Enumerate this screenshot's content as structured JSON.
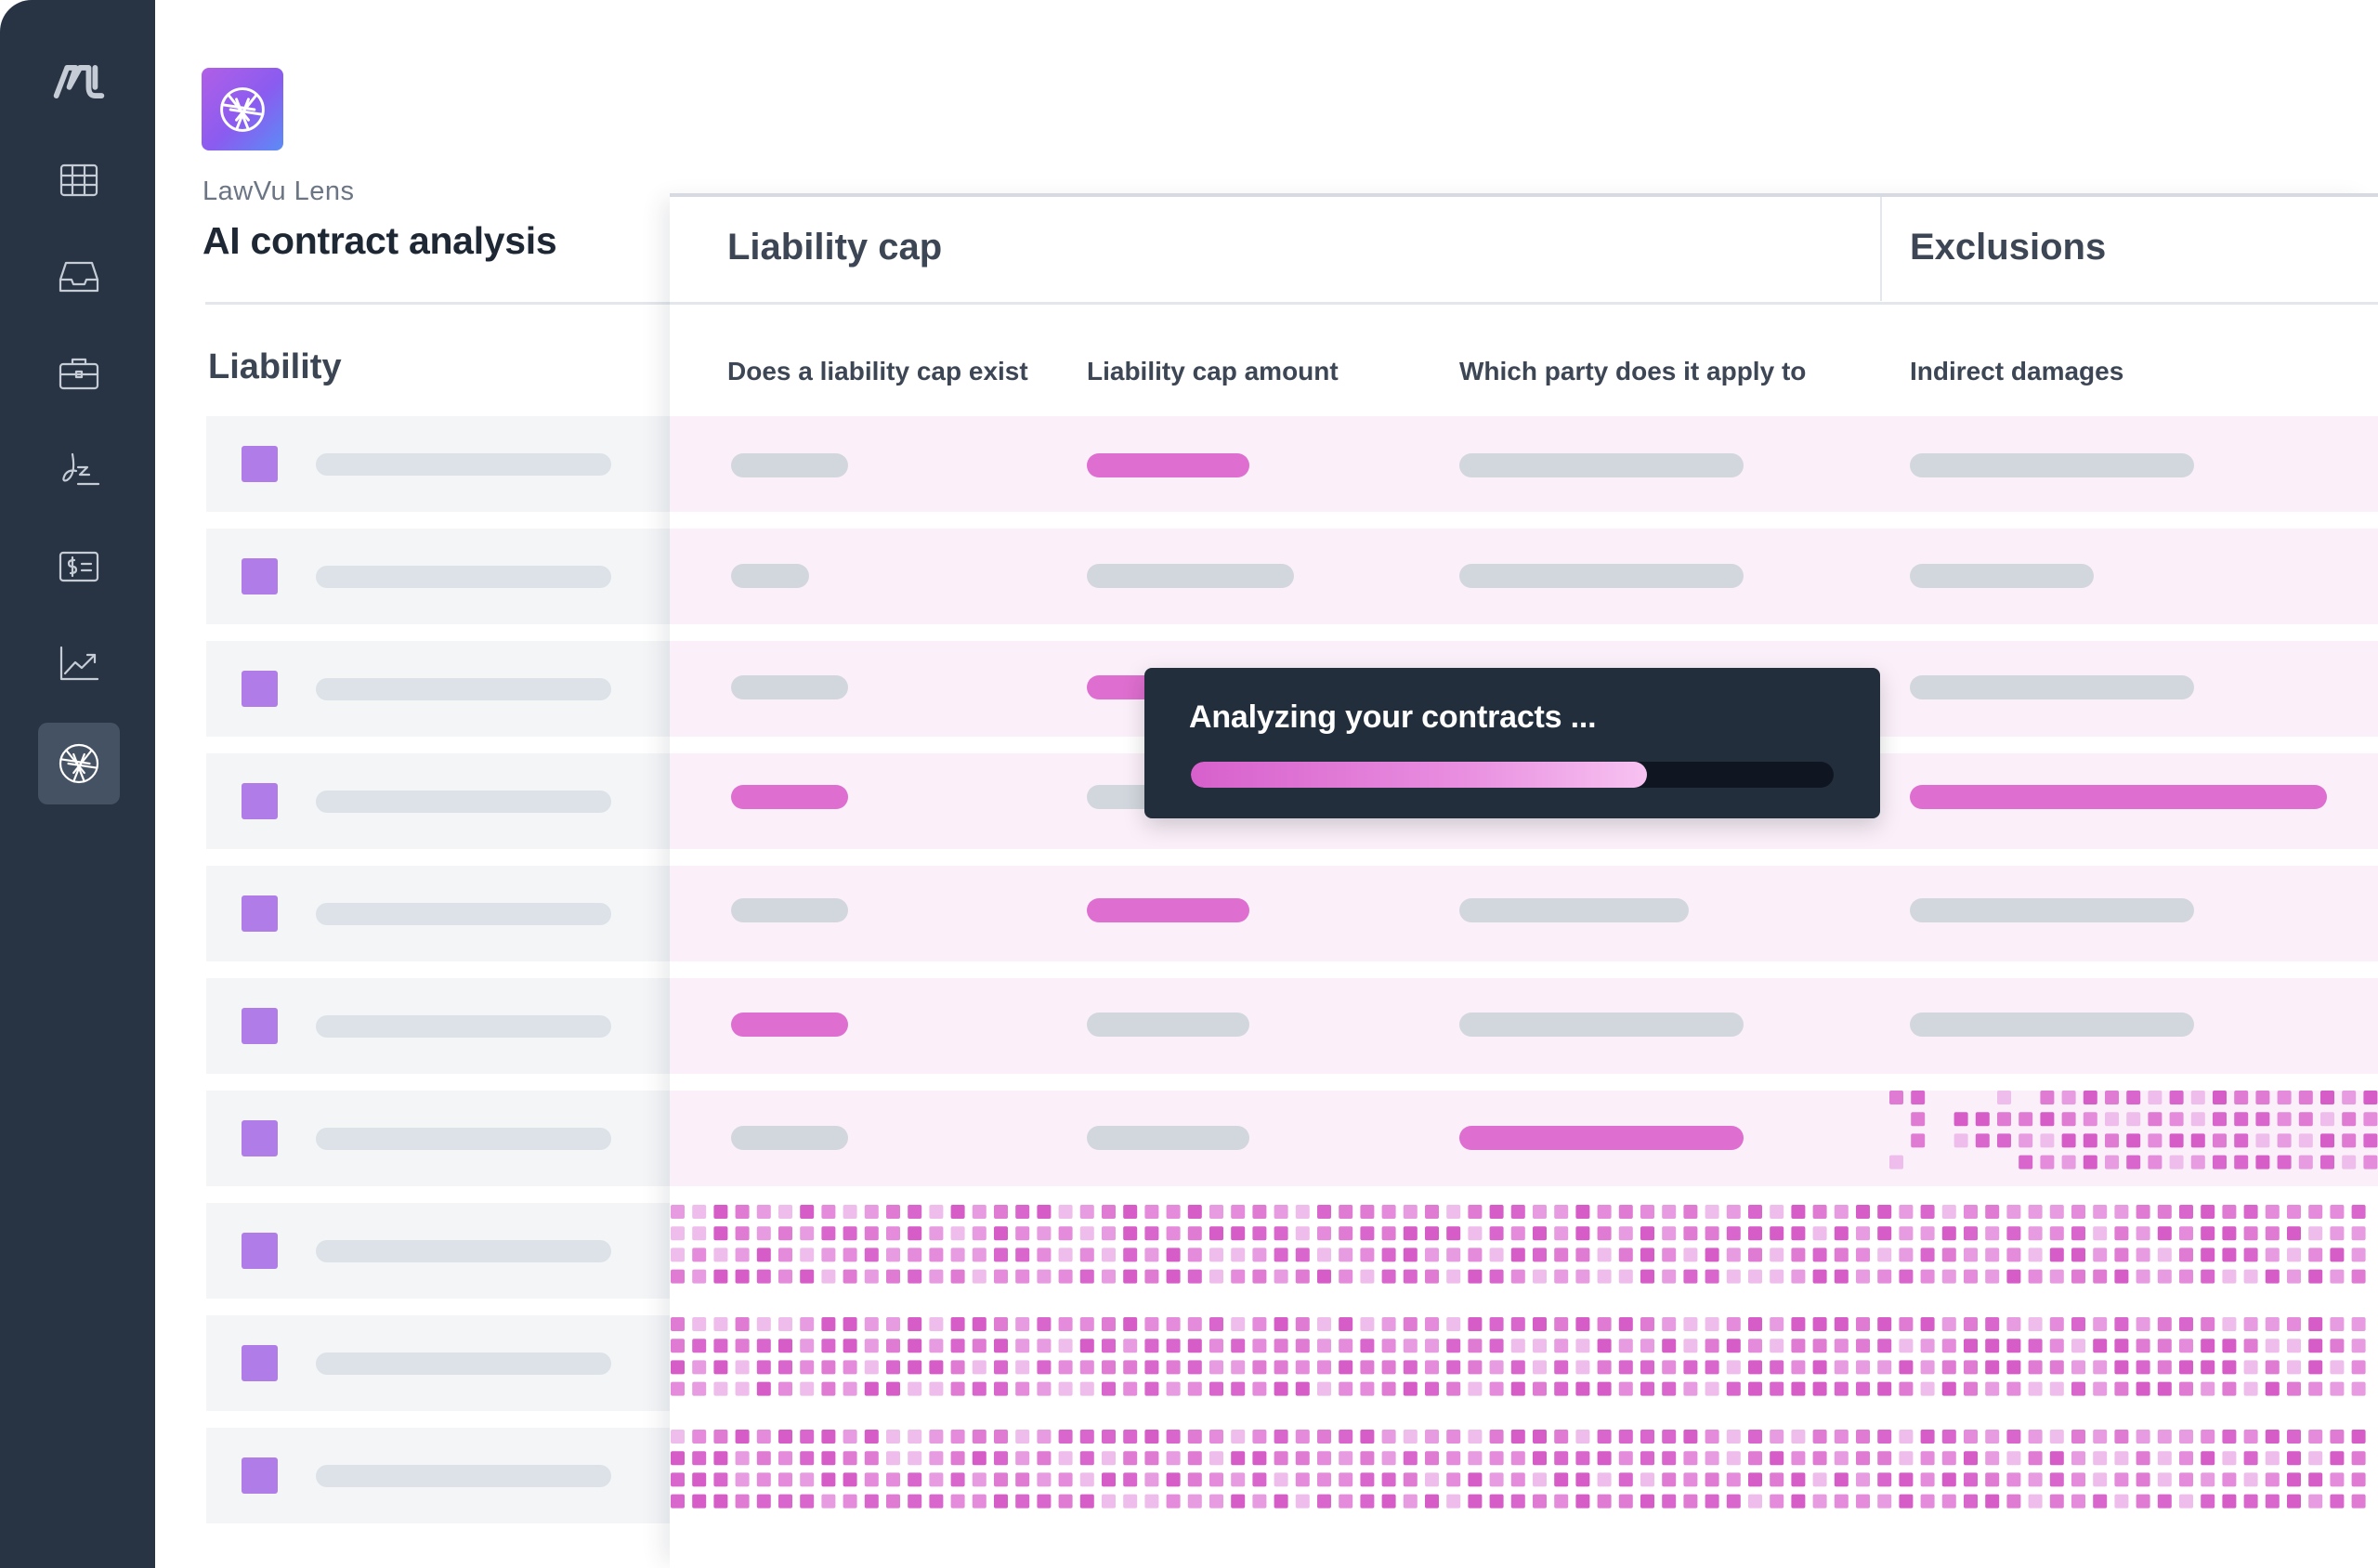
{
  "sidebar": {
    "brand_icon": "lawvu-logo-icon",
    "items": [
      {
        "icon": "table-grid-icon",
        "active": false
      },
      {
        "icon": "inbox-tray-icon",
        "active": false
      },
      {
        "icon": "briefcase-icon",
        "active": false
      },
      {
        "icon": "signature-icon",
        "active": false
      },
      {
        "icon": "billing-card-icon",
        "active": false
      },
      {
        "icon": "trend-chart-icon",
        "active": false
      },
      {
        "icon": "aperture-lens-icon",
        "active": true
      }
    ]
  },
  "header": {
    "app_icon": "aperture-lens-icon",
    "subtitle": "LawVu Lens",
    "title": "AI contract analysis"
  },
  "left_pane": {
    "section_title": "Liability",
    "row_count": 10
  },
  "table": {
    "groups": [
      {
        "label": "Liability cap"
      },
      {
        "label": "Exclusions"
      }
    ],
    "columns": [
      "Does a liability cap exist",
      "Liability cap amount",
      "Which party does it apply to",
      "Indirect damages"
    ]
  },
  "loader": {
    "text": "Analyzing your contracts ...",
    "progress": 0.71
  },
  "colors": {
    "sidebar": "#283444",
    "accent_pink": "#de6ecf",
    "checkbox_purple": "#b07de8",
    "row_tint": "#fbf0fa",
    "placeholder_gray": "#d2d7de"
  }
}
